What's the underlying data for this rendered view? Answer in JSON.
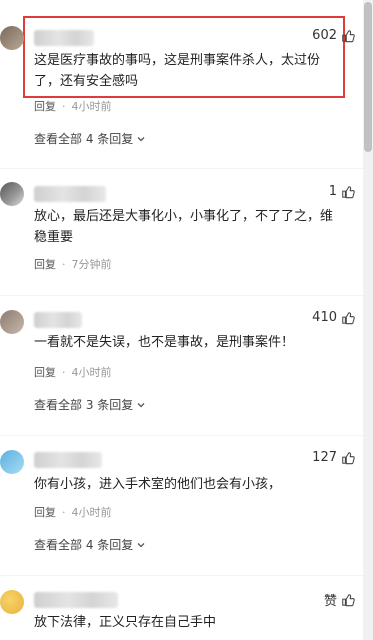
{
  "icons": {
    "like": "thumbs-up-icon",
    "chevron": "chevron-down-icon"
  },
  "colors": {
    "highlight": "#e03a3a"
  },
  "comments": [
    {
      "likes": "602",
      "text": "这是医疗事故的事吗，这是刑事案件杀人，太过份了，还有安全感吗",
      "reply": "回复",
      "time": "4小时前",
      "view_all": "查看全部 4 条回复"
    },
    {
      "likes": "1",
      "text": "放心，最后还是大事化小，小事化了，不了了之，维稳重要",
      "reply": "回复",
      "time": "7分钟前"
    },
    {
      "likes": "410",
      "text": "一看就不是失误，也不是事故，是刑事案件！",
      "reply": "回复",
      "time": "4小时前",
      "view_all": "查看全部 3 条回复"
    },
    {
      "likes": "127",
      "text": "你有小孩，进入手术室的他们也会有小孩，",
      "reply": "回复",
      "time": "4小时前",
      "view_all": "查看全部 4 条回复"
    },
    {
      "likes": "赞",
      "text": "放下法律，正义只存在自己手中"
    }
  ]
}
